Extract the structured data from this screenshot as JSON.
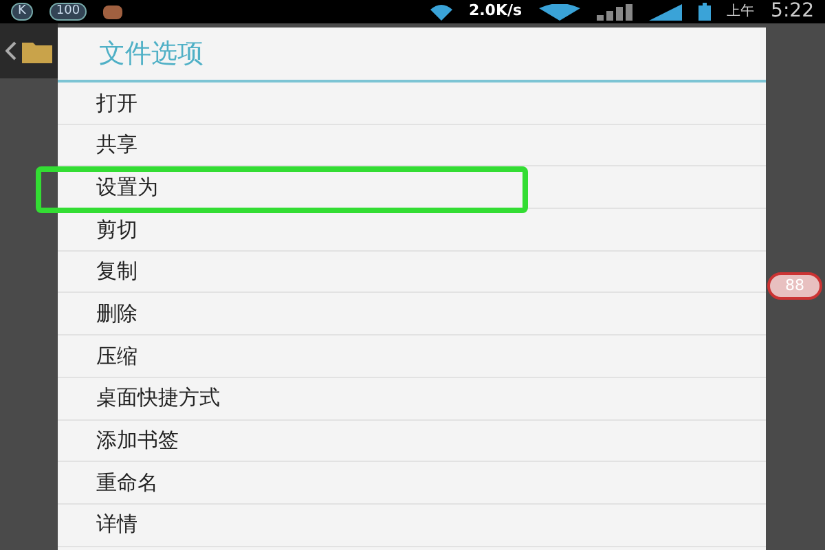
{
  "status_bar": {
    "icon_badges": [
      "K",
      "100"
    ],
    "speed": "2.0K/s",
    "period": "上午",
    "time": "5:22"
  },
  "dialog": {
    "title": "文件选项",
    "items": [
      {
        "label": "打开",
        "highlighted": false
      },
      {
        "label": "共享",
        "highlighted": false
      },
      {
        "label": "设置为",
        "highlighted": true
      },
      {
        "label": "剪切",
        "highlighted": false
      },
      {
        "label": "复制",
        "highlighted": false
      },
      {
        "label": "删除",
        "highlighted": false
      },
      {
        "label": "压缩",
        "highlighted": false
      },
      {
        "label": "桌面快捷方式",
        "highlighted": false
      },
      {
        "label": "添加书签",
        "highlighted": false
      },
      {
        "label": "重命名",
        "highlighted": false
      },
      {
        "label": "详情",
        "highlighted": false
      }
    ]
  },
  "floating_badge": "88"
}
